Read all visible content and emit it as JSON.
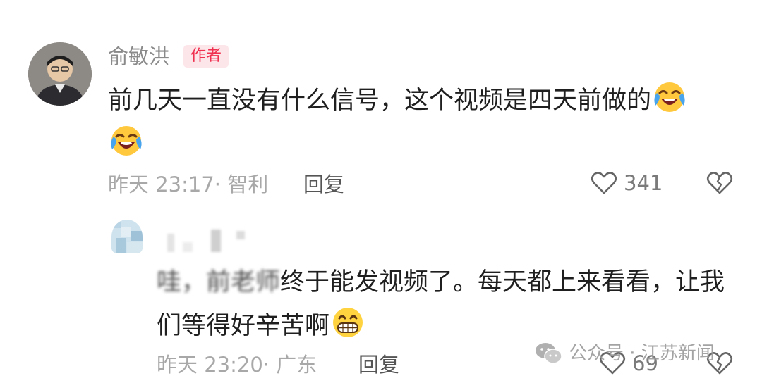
{
  "comment1": {
    "username": "俞敏洪",
    "badge": "作者",
    "text": "前几天一直没有什么信号，这个视频是四天前做的",
    "emoji": "crying-laughing-emoji",
    "time": "昨天 23:17· 智利",
    "reply_label": "回复",
    "like_count": "341"
  },
  "comment2": {
    "text_blurred_part": "哇，前老师",
    "text": "终于能发视频了。每天都上来看看，让我们等得好辛苦啊",
    "emoji": "grinning-emoji",
    "time": "昨天 23:20· 广东",
    "reply_label": "回复",
    "like_count": "69"
  },
  "watermark": {
    "text": "公众号 · 江苏新闻",
    "icon": "wechat-icon"
  },
  "colors": {
    "badge_bg": "#fde6ea",
    "badge_text": "#f0304f",
    "meta_text": "#a8a8a8",
    "body_text": "#1f1f1f"
  }
}
